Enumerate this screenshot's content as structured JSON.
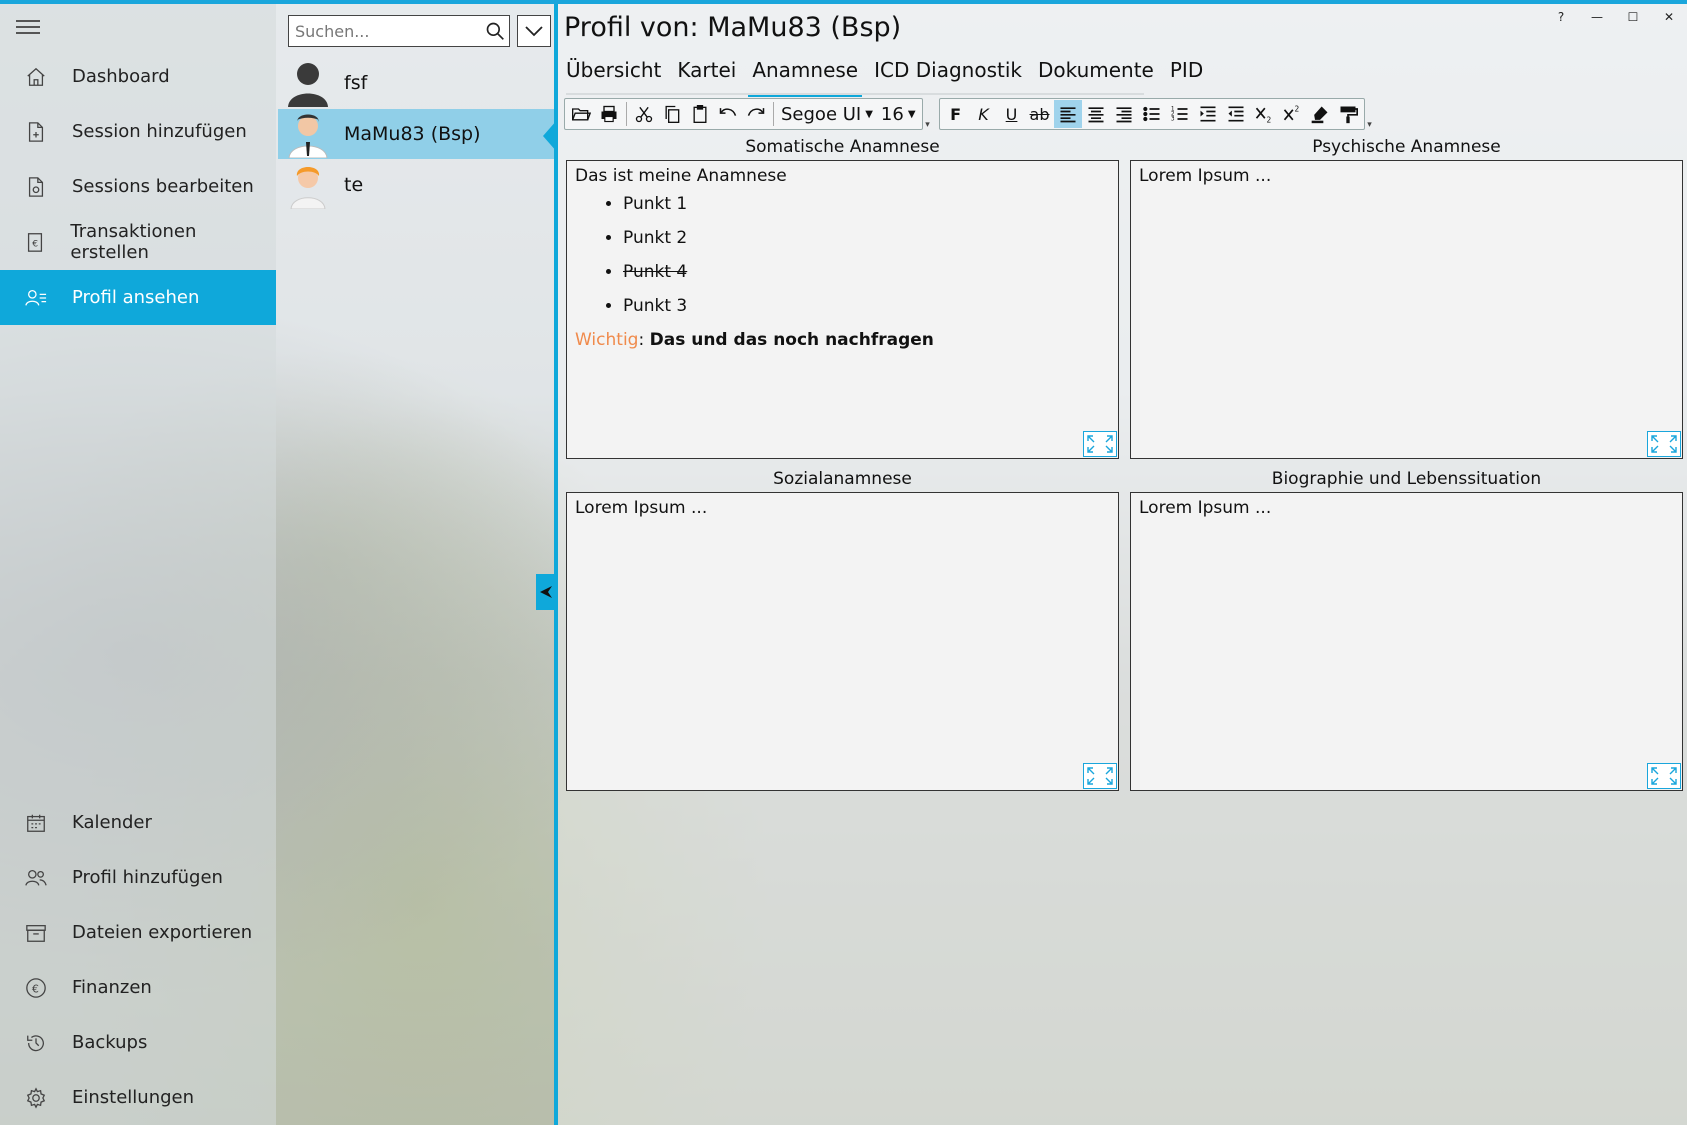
{
  "sidebar": {
    "top_items": [
      {
        "label": "Dashboard",
        "icon": "home-icon"
      },
      {
        "label": "Session hinzufügen",
        "icon": "document-add-icon"
      },
      {
        "label": "Sessions bearbeiten",
        "icon": "document-edit-icon"
      },
      {
        "label": "Transaktionen erstellen",
        "icon": "euro-document-icon"
      },
      {
        "label": "Profil ansehen",
        "icon": "profile-list-icon",
        "active": true
      }
    ],
    "bottom_items": [
      {
        "label": "Kalender",
        "icon": "calendar-icon"
      },
      {
        "label": "Profil hinzufügen",
        "icon": "people-add-icon"
      },
      {
        "label": "Dateien exportieren",
        "icon": "archive-icon"
      },
      {
        "label": "Finanzen",
        "icon": "euro-circle-icon"
      },
      {
        "label": "Backups",
        "icon": "history-icon"
      },
      {
        "label": "Einstellungen",
        "icon": "gear-icon"
      }
    ]
  },
  "patients": {
    "search_placeholder": "Suchen...",
    "items": [
      {
        "name": "fsf",
        "avatar": "silhouette"
      },
      {
        "name": "MaMu83 (Bsp)",
        "avatar": "man-tie",
        "selected": true
      },
      {
        "name": "te",
        "avatar": "child"
      }
    ]
  },
  "main": {
    "title": "Profil von: MaMu83 (Bsp)",
    "window_controls": [
      "?",
      "—",
      "☐",
      "✕"
    ],
    "tabs": [
      "Übersicht",
      "Kartei",
      "Anamnese",
      "ICD Diagnostik",
      "Dokumente",
      "PID"
    ],
    "active_tab": "Anamnese",
    "toolbar": {
      "font": "Segoe UI",
      "size": "16",
      "bold_label": "F",
      "italic_label": "K",
      "underline_label": "U",
      "strike_label": "ab"
    },
    "panels": {
      "somatic": {
        "label": "Somatische Anamnese",
        "intro": "Das ist meine Anamnese",
        "bullets": [
          "Punkt 1",
          "Punkt 2",
          "Punkt 4",
          "Punkt 3"
        ],
        "warn_label": "Wichtig",
        "warn_sep": ":",
        "warn_text": "Das und das noch nachfragen"
      },
      "psychic": {
        "label": "Psychische Anamnese",
        "text": "Lorem Ipsum ..."
      },
      "social": {
        "label": "Sozialanamnese",
        "text": "Lorem Ipsum ..."
      },
      "biography": {
        "label": "Biographie und Lebenssituation",
        "text": "Lorem Ipsum ..."
      }
    }
  },
  "colors": {
    "accent": "#0fa8da",
    "selected_patient": "#90cfe8",
    "warning": "#f08a4b"
  }
}
